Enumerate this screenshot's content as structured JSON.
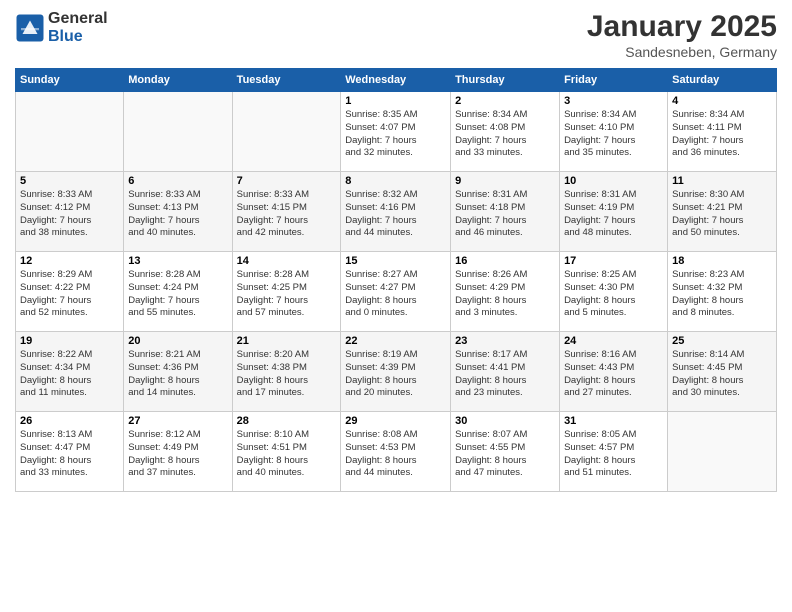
{
  "header": {
    "logo_general": "General",
    "logo_blue": "Blue",
    "month_title": "January 2025",
    "subtitle": "Sandesneben, Germany"
  },
  "days_of_week": [
    "Sunday",
    "Monday",
    "Tuesday",
    "Wednesday",
    "Thursday",
    "Friday",
    "Saturday"
  ],
  "weeks": [
    [
      {
        "day": "",
        "info": ""
      },
      {
        "day": "",
        "info": ""
      },
      {
        "day": "",
        "info": ""
      },
      {
        "day": "1",
        "info": "Sunrise: 8:35 AM\nSunset: 4:07 PM\nDaylight: 7 hours\nand 32 minutes."
      },
      {
        "day": "2",
        "info": "Sunrise: 8:34 AM\nSunset: 4:08 PM\nDaylight: 7 hours\nand 33 minutes."
      },
      {
        "day": "3",
        "info": "Sunrise: 8:34 AM\nSunset: 4:10 PM\nDaylight: 7 hours\nand 35 minutes."
      },
      {
        "day": "4",
        "info": "Sunrise: 8:34 AM\nSunset: 4:11 PM\nDaylight: 7 hours\nand 36 minutes."
      }
    ],
    [
      {
        "day": "5",
        "info": "Sunrise: 8:33 AM\nSunset: 4:12 PM\nDaylight: 7 hours\nand 38 minutes."
      },
      {
        "day": "6",
        "info": "Sunrise: 8:33 AM\nSunset: 4:13 PM\nDaylight: 7 hours\nand 40 minutes."
      },
      {
        "day": "7",
        "info": "Sunrise: 8:33 AM\nSunset: 4:15 PM\nDaylight: 7 hours\nand 42 minutes."
      },
      {
        "day": "8",
        "info": "Sunrise: 8:32 AM\nSunset: 4:16 PM\nDaylight: 7 hours\nand 44 minutes."
      },
      {
        "day": "9",
        "info": "Sunrise: 8:31 AM\nSunset: 4:18 PM\nDaylight: 7 hours\nand 46 minutes."
      },
      {
        "day": "10",
        "info": "Sunrise: 8:31 AM\nSunset: 4:19 PM\nDaylight: 7 hours\nand 48 minutes."
      },
      {
        "day": "11",
        "info": "Sunrise: 8:30 AM\nSunset: 4:21 PM\nDaylight: 7 hours\nand 50 minutes."
      }
    ],
    [
      {
        "day": "12",
        "info": "Sunrise: 8:29 AM\nSunset: 4:22 PM\nDaylight: 7 hours\nand 52 minutes."
      },
      {
        "day": "13",
        "info": "Sunrise: 8:28 AM\nSunset: 4:24 PM\nDaylight: 7 hours\nand 55 minutes."
      },
      {
        "day": "14",
        "info": "Sunrise: 8:28 AM\nSunset: 4:25 PM\nDaylight: 7 hours\nand 57 minutes."
      },
      {
        "day": "15",
        "info": "Sunrise: 8:27 AM\nSunset: 4:27 PM\nDaylight: 8 hours\nand 0 minutes."
      },
      {
        "day": "16",
        "info": "Sunrise: 8:26 AM\nSunset: 4:29 PM\nDaylight: 8 hours\nand 3 minutes."
      },
      {
        "day": "17",
        "info": "Sunrise: 8:25 AM\nSunset: 4:30 PM\nDaylight: 8 hours\nand 5 minutes."
      },
      {
        "day": "18",
        "info": "Sunrise: 8:23 AM\nSunset: 4:32 PM\nDaylight: 8 hours\nand 8 minutes."
      }
    ],
    [
      {
        "day": "19",
        "info": "Sunrise: 8:22 AM\nSunset: 4:34 PM\nDaylight: 8 hours\nand 11 minutes."
      },
      {
        "day": "20",
        "info": "Sunrise: 8:21 AM\nSunset: 4:36 PM\nDaylight: 8 hours\nand 14 minutes."
      },
      {
        "day": "21",
        "info": "Sunrise: 8:20 AM\nSunset: 4:38 PM\nDaylight: 8 hours\nand 17 minutes."
      },
      {
        "day": "22",
        "info": "Sunrise: 8:19 AM\nSunset: 4:39 PM\nDaylight: 8 hours\nand 20 minutes."
      },
      {
        "day": "23",
        "info": "Sunrise: 8:17 AM\nSunset: 4:41 PM\nDaylight: 8 hours\nand 23 minutes."
      },
      {
        "day": "24",
        "info": "Sunrise: 8:16 AM\nSunset: 4:43 PM\nDaylight: 8 hours\nand 27 minutes."
      },
      {
        "day": "25",
        "info": "Sunrise: 8:14 AM\nSunset: 4:45 PM\nDaylight: 8 hours\nand 30 minutes."
      }
    ],
    [
      {
        "day": "26",
        "info": "Sunrise: 8:13 AM\nSunset: 4:47 PM\nDaylight: 8 hours\nand 33 minutes."
      },
      {
        "day": "27",
        "info": "Sunrise: 8:12 AM\nSunset: 4:49 PM\nDaylight: 8 hours\nand 37 minutes."
      },
      {
        "day": "28",
        "info": "Sunrise: 8:10 AM\nSunset: 4:51 PM\nDaylight: 8 hours\nand 40 minutes."
      },
      {
        "day": "29",
        "info": "Sunrise: 8:08 AM\nSunset: 4:53 PM\nDaylight: 8 hours\nand 44 minutes."
      },
      {
        "day": "30",
        "info": "Sunrise: 8:07 AM\nSunset: 4:55 PM\nDaylight: 8 hours\nand 47 minutes."
      },
      {
        "day": "31",
        "info": "Sunrise: 8:05 AM\nSunset: 4:57 PM\nDaylight: 8 hours\nand 51 minutes."
      },
      {
        "day": "",
        "info": ""
      }
    ]
  ]
}
